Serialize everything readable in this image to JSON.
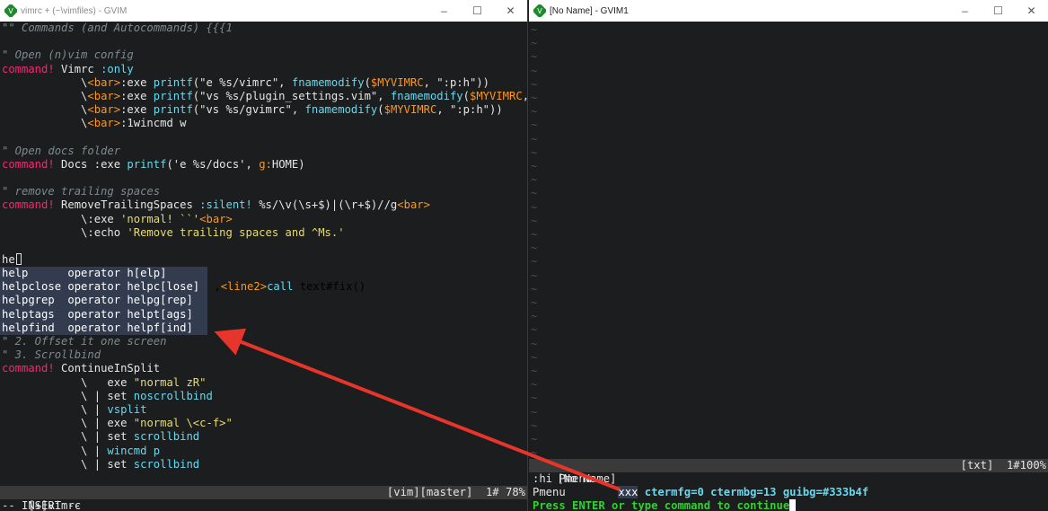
{
  "left_window": {
    "title": "vimrc + (~\\vimfiles) - GVIM",
    "controls": {
      "minimize": "–",
      "maximize": "☐",
      "close": "✕"
    },
    "code_lines": [
      [
        {
          "t": "\"\" Commands (and Autocommands) {{{1",
          "c": "cm"
        }
      ],
      [
        {
          "t": "",
          "c": ""
        }
      ],
      [
        {
          "t": "\" Open (n)vim config",
          "c": "cm"
        }
      ],
      [
        {
          "t": "command! ",
          "c": "kw"
        },
        {
          "t": "Vimrc ",
          "c": ""
        },
        {
          "t": ":only",
          "c": "fn"
        }
      ],
      [
        {
          "t": "            \\",
          "c": ""
        },
        {
          "t": "<bar>",
          "c": "tag"
        },
        {
          "t": ":exe ",
          "c": ""
        },
        {
          "t": "printf",
          "c": "fn"
        },
        {
          "t": "(\"e %s/vimrc\", ",
          "c": ""
        },
        {
          "t": "fnamemodify",
          "c": "fn"
        },
        {
          "t": "(",
          "c": ""
        },
        {
          "t": "$MYVIMRC",
          "c": "var"
        },
        {
          "t": ", \":p:h\"))",
          "c": ""
        }
      ],
      [
        {
          "t": "            \\",
          "c": ""
        },
        {
          "t": "<bar>",
          "c": "tag"
        },
        {
          "t": ":exe ",
          "c": ""
        },
        {
          "t": "printf",
          "c": "fn"
        },
        {
          "t": "(\"vs %s/plugin_settings.vim\", ",
          "c": ""
        },
        {
          "t": "fnamemodify",
          "c": "fn"
        },
        {
          "t": "(",
          "c": ""
        },
        {
          "t": "$MYVIMRC",
          "c": "var"
        },
        {
          "t": ", \"",
          "c": ""
        }
      ],
      [
        {
          "t": "            \\",
          "c": ""
        },
        {
          "t": "<bar>",
          "c": "tag"
        },
        {
          "t": ":exe ",
          "c": ""
        },
        {
          "t": "printf",
          "c": "fn"
        },
        {
          "t": "(\"vs %s/gvimrc\", ",
          "c": ""
        },
        {
          "t": "fnamemodify",
          "c": "fn"
        },
        {
          "t": "(",
          "c": ""
        },
        {
          "t": "$MYVIMRC",
          "c": "var"
        },
        {
          "t": ", \":p:h\"))",
          "c": ""
        }
      ],
      [
        {
          "t": "            \\",
          "c": ""
        },
        {
          "t": "<bar>",
          "c": "tag"
        },
        {
          "t": ":1wincmd w",
          "c": ""
        }
      ],
      [
        {
          "t": "",
          "c": ""
        }
      ],
      [
        {
          "t": "\" Open docs folder",
          "c": "cm"
        }
      ],
      [
        {
          "t": "command! ",
          "c": "kw"
        },
        {
          "t": "Docs :exe ",
          "c": ""
        },
        {
          "t": "printf",
          "c": "fn"
        },
        {
          "t": "('e %s/docs', ",
          "c": ""
        },
        {
          "t": "g:",
          "c": "var"
        },
        {
          "t": "HOME)",
          "c": ""
        }
      ],
      [
        {
          "t": "",
          "c": ""
        }
      ],
      [
        {
          "t": "\" remove trailing spaces",
          "c": "cm"
        }
      ],
      [
        {
          "t": "command! ",
          "c": "kw"
        },
        {
          "t": "RemoveTrailingSpaces ",
          "c": ""
        },
        {
          "t": ":silent! ",
          "c": "fn"
        },
        {
          "t": "%s/\\v(\\s+$)|(\\r+$)//g",
          "c": ""
        },
        {
          "t": "<bar>",
          "c": "tag"
        }
      ],
      [
        {
          "t": "            \\",
          "c": ""
        },
        {
          "t": ":exe ",
          "c": ""
        },
        {
          "t": "'normal! ``'",
          "c": "str"
        },
        {
          "t": "<bar>",
          "c": "tag"
        }
      ],
      [
        {
          "t": "            \\",
          "c": ""
        },
        {
          "t": ":echo ",
          "c": ""
        },
        {
          "t": "'Remove trailing spaces and ^Ms.'",
          "c": "str"
        }
      ],
      [
        {
          "t": "",
          "c": ""
        }
      ],
      [
        {
          "t": "he",
          "c": ""
        }
      ]
    ],
    "popup_menu": [
      "help      operator h[elp]",
      "helpclose operator helpc[lose]",
      "helpgrep  operator helpg[rep]",
      "helptags  operator helpt[ags]",
      "helpfind  operator helpf[ind]"
    ],
    "popup_trailing": [
      {
        "t": " ,",
        "c": ""
      },
      {
        "t": "<line2>",
        "c": "tag"
      },
      {
        "t": "call ",
        "c": "fn"
      },
      {
        "t": "text#fix()",
        "c": ""
      }
    ],
    "code_lines_after": [
      [
        {
          "t": "\" 2. Offset it one screen",
          "c": "cm"
        }
      ],
      [
        {
          "t": "\" 3. Scrollbind",
          "c": "cm"
        }
      ],
      [
        {
          "t": "command! ",
          "c": "kw"
        },
        {
          "t": "ContinueInSplit",
          "c": ""
        }
      ],
      [
        {
          "t": "            \\   ",
          "c": ""
        },
        {
          "t": "exe ",
          "c": ""
        },
        {
          "t": "\"normal zR\"",
          "c": "str"
        }
      ],
      [
        {
          "t": "            \\ | ",
          "c": ""
        },
        {
          "t": "set ",
          "c": ""
        },
        {
          "t": "noscrollbind",
          "c": "fn"
        }
      ],
      [
        {
          "t": "            \\ | ",
          "c": ""
        },
        {
          "t": "vsplit",
          "c": "fn"
        }
      ],
      [
        {
          "t": "            \\ | ",
          "c": ""
        },
        {
          "t": "exe ",
          "c": ""
        },
        {
          "t": "\"normal \\<c-f>\"",
          "c": "str"
        }
      ],
      [
        {
          "t": "            \\ | ",
          "c": ""
        },
        {
          "t": "set ",
          "c": ""
        },
        {
          "t": "scrollbind",
          "c": "fn"
        }
      ],
      [
        {
          "t": "            \\ | ",
          "c": ""
        },
        {
          "t": "wincmd p",
          "c": "fn"
        }
      ],
      [
        {
          "t": "            \\ | ",
          "c": ""
        },
        {
          "t": "set ",
          "c": ""
        },
        {
          "t": "scrollbind",
          "c": "fn"
        }
      ]
    ],
    "statusline_left": "[+]vimrc",
    "statusline_right": "[vim][master]  1# 78%",
    "mode": "-- INSERT --"
  },
  "right_window": {
    "title": "[No Name] - GVIM1",
    "controls": {
      "minimize": "–",
      "maximize": "☐",
      "close": "✕"
    },
    "tilde": "~",
    "statusline_left": "[No Name]",
    "statusline_right": "[txt]  1#100%",
    "cmd_echo": ":hi Pmenu",
    "hl_group": "Pmenu",
    "hl_sample": "xxx",
    "hl_attrs": "ctermfg=0 ctermbg=13 guibg=#333b4f",
    "prompt": "Press ENTER or type command to continue"
  },
  "colors": {
    "pmenu_bg": "#333b4f",
    "arrow": "#e8352b",
    "prompt_green": "#2fd32f"
  }
}
